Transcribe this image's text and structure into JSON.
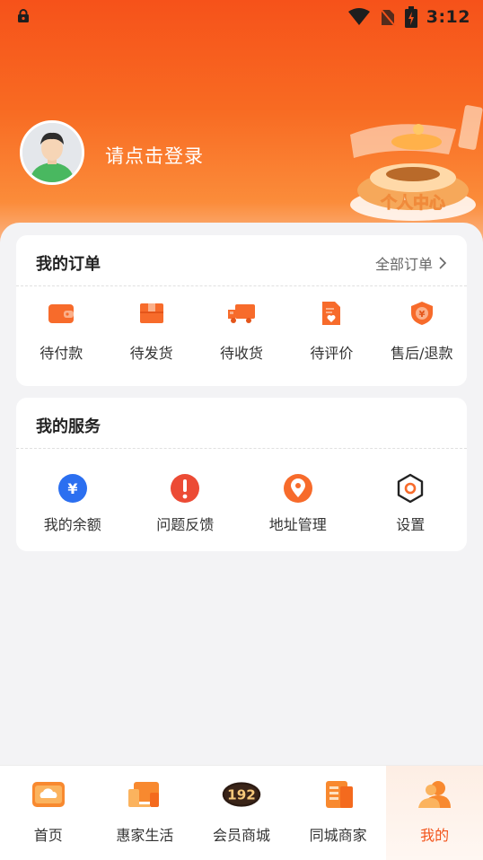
{
  "status_bar": {
    "time": "3:12"
  },
  "profile": {
    "login_prompt": "请点击登录",
    "decor_text": "个人中心"
  },
  "orders": {
    "title": "我的订单",
    "all_link": "全部订单",
    "items": [
      {
        "label": "待付款",
        "icon": "wallet-icon"
      },
      {
        "label": "待发货",
        "icon": "box-icon"
      },
      {
        "label": "待收货",
        "icon": "truck-icon"
      },
      {
        "label": "待评价",
        "icon": "review-doc-icon"
      },
      {
        "label": "售后/退款",
        "icon": "refund-shield-icon"
      }
    ]
  },
  "services": {
    "title": "我的服务",
    "items": [
      {
        "label": "我的余额",
        "icon": "yuan-icon"
      },
      {
        "label": "问题反馈",
        "icon": "exclamation-icon"
      },
      {
        "label": "地址管理",
        "icon": "location-pin-icon"
      },
      {
        "label": "设置",
        "icon": "settings-hexagon-icon"
      }
    ]
  },
  "bottom_nav": {
    "items": [
      {
        "label": "首页",
        "icon": "home-cloud-icon"
      },
      {
        "label": "惠家生活",
        "icon": "devices-icon"
      },
      {
        "label": "会员商城",
        "icon": "member-192-badge",
        "badge": "192"
      },
      {
        "label": "同城商家",
        "icon": "store-doc-icon"
      },
      {
        "label": "我的",
        "icon": "user-icon",
        "active": true
      }
    ]
  },
  "colors": {
    "accent": "#f2541b",
    "hero_top": "#f6521a",
    "blue": "#2b6ff0",
    "red": "#ec4b35",
    "orange": "#f76b2b"
  }
}
